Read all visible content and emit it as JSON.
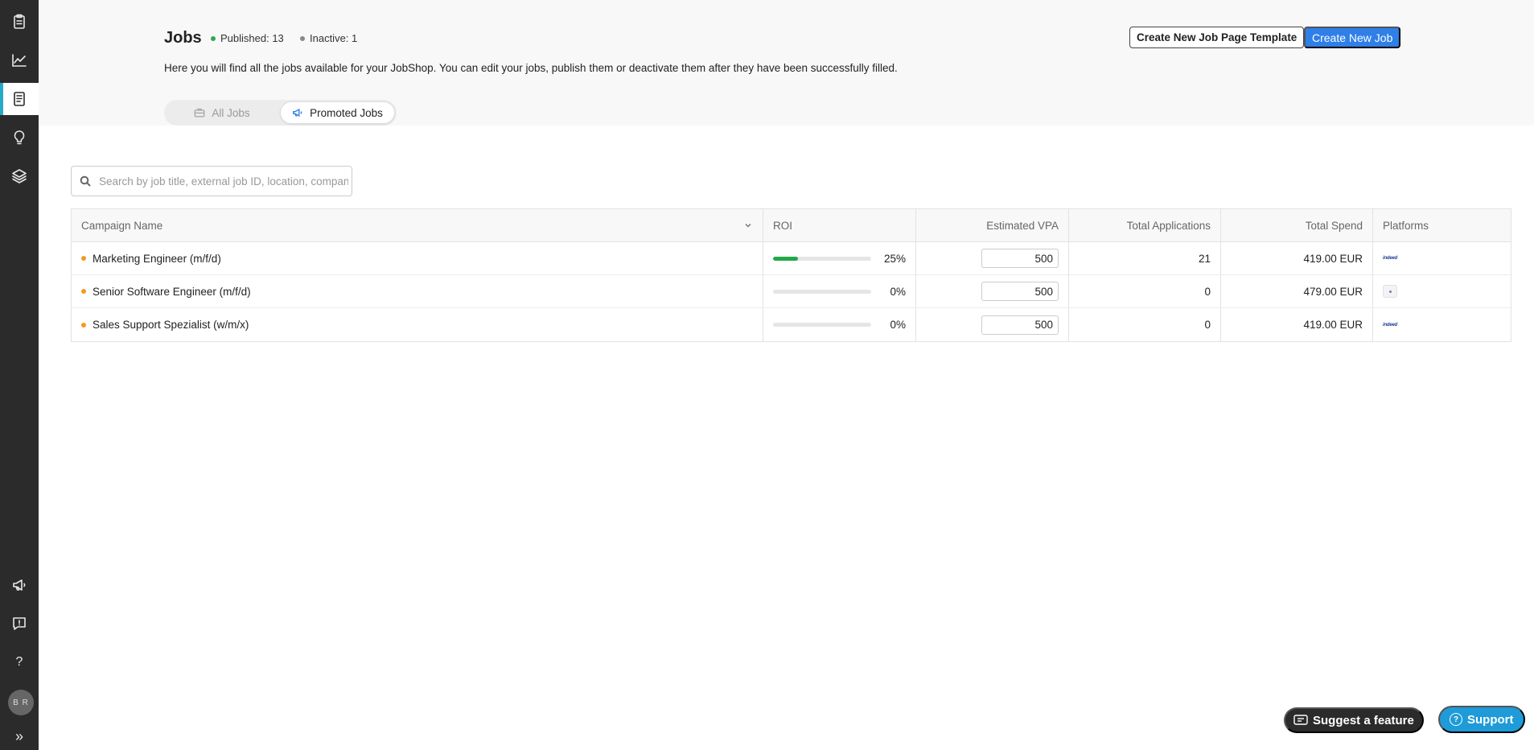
{
  "sidebar": {
    "items": [
      {
        "icon": "clipboard-icon"
      },
      {
        "icon": "chart-line-icon"
      },
      {
        "icon": "document-icon",
        "active": true
      },
      {
        "icon": "lightbulb-icon"
      },
      {
        "icon": "layers-icon"
      }
    ],
    "bottom": [
      {
        "icon": "megaphone-icon"
      },
      {
        "icon": "feedback-icon"
      },
      {
        "icon": "help-icon",
        "label": "?"
      },
      {
        "icon": "avatar",
        "label": "B R"
      },
      {
        "icon": "expand-icon",
        "label": "»"
      }
    ]
  },
  "header": {
    "title": "Jobs",
    "published": "Published: 13",
    "inactive": "Inactive: 1",
    "description": "Here you will find all the jobs available for your JobShop. You can edit your jobs, publish them or deactivate them after they have been successfully filled.",
    "template_button": "Create New Job Page Template",
    "new_job_button": "Create New Job",
    "colors": {
      "published": "#2fa84f",
      "inactive": "#888888",
      "primary": "#2f7fe8"
    }
  },
  "tabs": {
    "all": "All Jobs",
    "promoted": "Promoted Jobs",
    "active": "promoted"
  },
  "search": {
    "placeholder": "Search by job title, external job ID, location, company",
    "value": ""
  },
  "table": {
    "headers": {
      "name": "Campaign Name",
      "roi": "ROI",
      "vpa": "Estimated VPA",
      "applications": "Total Applications",
      "spend": "Total Spend",
      "platforms": "Platforms"
    },
    "rows": [
      {
        "name": "Marketing Engineer (m/f/d)",
        "status_color": "#f39a1e",
        "roi": "25%",
        "roi_fraction": 0.25,
        "vpa": "500",
        "applications": "21",
        "spend": "419.00 EUR",
        "platform": "indeed"
      },
      {
        "name": "Senior Software Engineer (m/f/d)",
        "status_color": "#f39a1e",
        "roi": "0%",
        "roi_fraction": 0,
        "vpa": "500",
        "applications": "0",
        "spend": "479.00 EUR",
        "platform": "generic"
      },
      {
        "name": "Sales Support Spezialist (w/m/x)",
        "status_color": "#f39a1e",
        "roi": "0%",
        "roi_fraction": 0,
        "vpa": "500",
        "applications": "0",
        "spend": "419.00 EUR",
        "platform": "indeed"
      }
    ]
  },
  "floating": {
    "suggest": "Suggest a feature",
    "support": "Support"
  },
  "platform_labels": {
    "indeed": "indeed"
  }
}
